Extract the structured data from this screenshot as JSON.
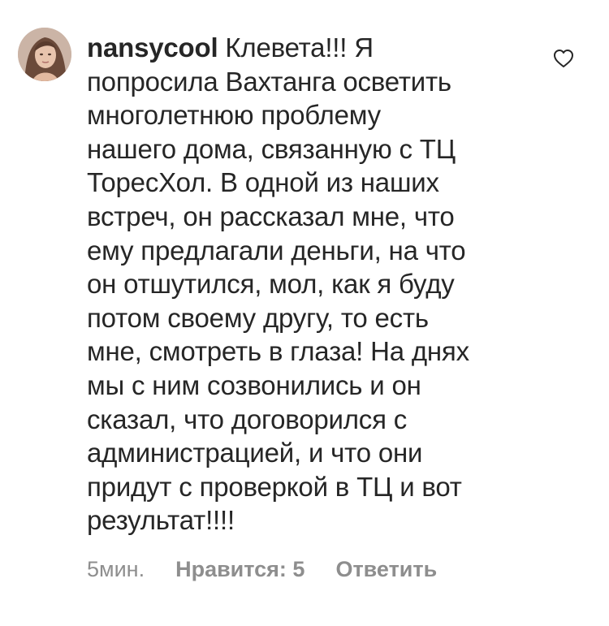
{
  "comment": {
    "username": "nansycool",
    "text": "Клевета!!! Я\nпопросила Вахтанга осветить\nмноголетнюю проблему\nнашего дома, связанную с ТЦ\nТоресХол. В одной из наших\nвстреч, он рассказал мне, что\nему предлагали деньги, на что\nон отшутился, мол, как я буду\nпотом своему другу, то есть\nмне, смотреть в глаза! На днях\nмы с ним созвонились и он\nсказал, что договорился с\nадминистрацией, и что они\nпридут с проверкой в ТЦ и вот\nрезультат!!!!",
    "time": "5мин.",
    "likes_label": "Нравится: 5",
    "reply_label": "Ответить",
    "like_icon": "heart-outline-icon"
  },
  "colors": {
    "text": "#262626",
    "meta": "#8e8e8e",
    "background": "#ffffff"
  }
}
